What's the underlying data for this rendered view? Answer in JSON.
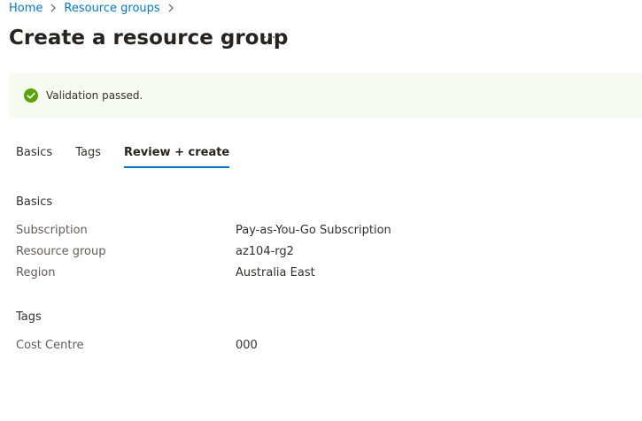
{
  "breadcrumb": {
    "items": [
      "Home",
      "Resource groups"
    ]
  },
  "header": {
    "title": "Create a resource group",
    "more_label": "···"
  },
  "banner": {
    "text": "Validation passed.",
    "status": "success",
    "icon": "check-circle-icon",
    "color": "#57a300",
    "background": "#f5fbf0"
  },
  "tabs": [
    {
      "label": "Basics",
      "active": false
    },
    {
      "label": "Tags",
      "active": false
    },
    {
      "label": "Review + create",
      "active": true
    }
  ],
  "sections": {
    "basics": {
      "heading": "Basics",
      "rows": [
        {
          "label": "Subscription",
          "value": "Pay-as-You-Go Subscription"
        },
        {
          "label": "Resource group",
          "value": "az104-rg2"
        },
        {
          "label": "Region",
          "value": "Australia East"
        }
      ]
    },
    "tags": {
      "heading": "Tags",
      "rows": [
        {
          "label": "Cost Centre",
          "value": "000"
        }
      ]
    }
  },
  "colors": {
    "accent": "#0078d4",
    "success": "#57a300"
  }
}
